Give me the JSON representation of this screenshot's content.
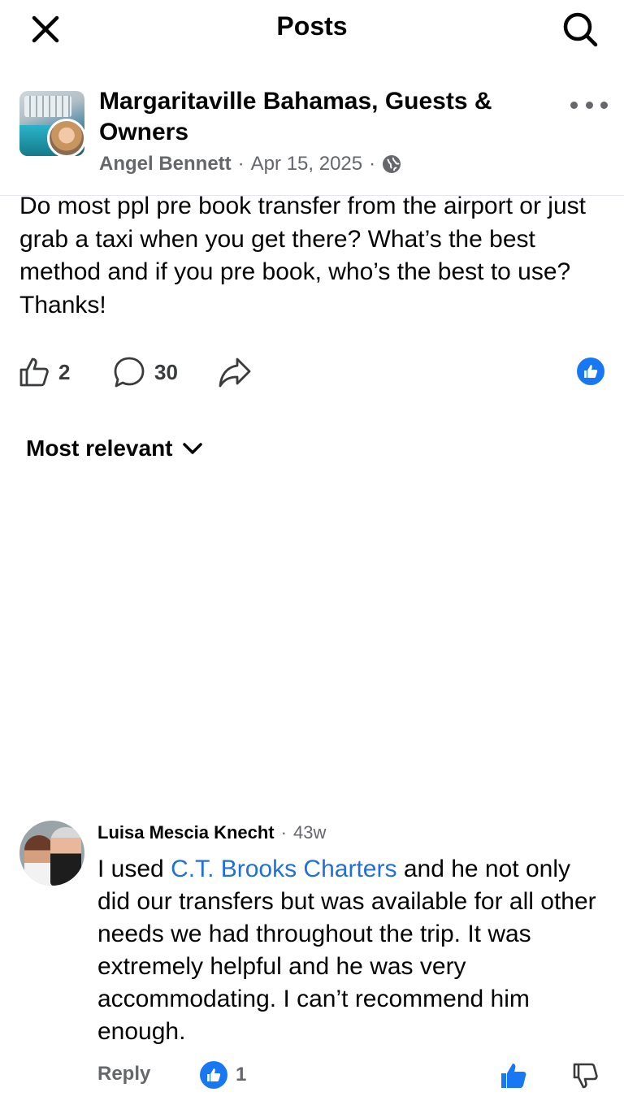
{
  "header": {
    "title": "Posts",
    "close_icon": "close-icon",
    "search_icon": "search-icon"
  },
  "post": {
    "group_name": "Margaritaville Bahamas, Guests & Owners",
    "author": "Angel Bennett",
    "date": "Apr 15, 2025",
    "privacy_icon": "globe-icon",
    "text": "Do most ppl pre book transfer from the airport or just grab a taxi when you get there? What’s the best method and if you pre book, who’s the best to use? Thanks!",
    "like_count": "2",
    "comment_count": "30",
    "reaction_color": "#1877f2"
  },
  "sort": {
    "label": "Most relevant"
  },
  "comment": {
    "author": "Luisa Mescia Knecht",
    "time": "43w",
    "text_before": "I used ",
    "link": "C.T. Brooks Charters",
    "text_after": " and he not only did our transfers but was available for all other needs we had throughout the trip. It was extremely helpful and he was very accommodating. I can’t recommend him enough.",
    "reply_label": "Reply",
    "reaction_count": "1",
    "link_color": "#216fdb"
  }
}
